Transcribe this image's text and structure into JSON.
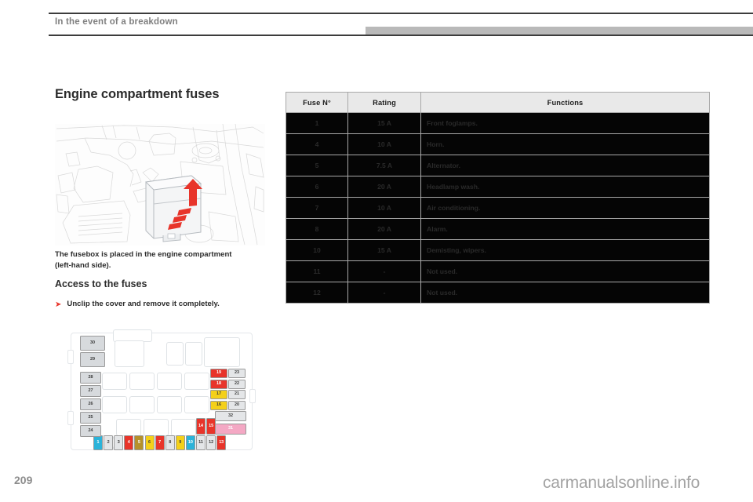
{
  "header": {
    "title": "In the event of a breakdown",
    "tab_icon": "progress-tab-bar"
  },
  "left": {
    "section_title": "Engine compartment fuses",
    "photo_icon": "engine-compartment-fusebox-photo",
    "body_text": "The fusebox is placed in the engine compartment (left-hand side).",
    "subsection_title": "Access to the fuses",
    "bullet_arrow_icon": "red-arrow-bullet-icon",
    "bullet_text": "Unclip the cover and remove it completely.",
    "diagram_icon": "fusebox-layout-diagram"
  },
  "table": {
    "columns": [
      "Fuse N°",
      "Rating",
      "Functions"
    ],
    "rows": [
      {
        "num": "1",
        "rating": "15 A",
        "func": "Front foglamps."
      },
      {
        "num": "4",
        "rating": "10 A",
        "func": "Horn."
      },
      {
        "num": "5",
        "rating": "7.5 A",
        "func": "Alternator."
      },
      {
        "num": "6",
        "rating": "20 A",
        "func": "Headlamp wash."
      },
      {
        "num": "7",
        "rating": "10 A",
        "func": "Air conditioning."
      },
      {
        "num": "8",
        "rating": "20 A",
        "func": "Alarm."
      },
      {
        "num": "10",
        "rating": "15 A",
        "func": "Demisting, wipers."
      },
      {
        "num": "11",
        "rating": "-",
        "func": "Not used."
      },
      {
        "num": "12",
        "rating": "-",
        "func": "Not used."
      }
    ]
  },
  "diagram_data": {
    "bottom_row": [
      {
        "label": "1",
        "color": "#2bb3d9",
        "text": "#ffffff"
      },
      {
        "label": "2",
        "color": "#e4e6e8",
        "text": "#3a3a3a"
      },
      {
        "label": "3",
        "color": "#e4e6e8",
        "text": "#3a3a3a"
      },
      {
        "label": "4",
        "color": "#e8342a",
        "text": "#ffffff"
      },
      {
        "label": "5",
        "color": "#b5912c",
        "text": "#ffffff"
      },
      {
        "label": "6",
        "color": "#f4d019",
        "text": "#3a3a3a"
      },
      {
        "label": "7",
        "color": "#e8342a",
        "text": "#ffffff"
      },
      {
        "label": "8",
        "color": "#e4e6e8",
        "text": "#3a3a3a"
      },
      {
        "label": "9",
        "color": "#f4d019",
        "text": "#3a3a3a"
      },
      {
        "label": "10",
        "color": "#2bb3d9",
        "text": "#ffffff"
      },
      {
        "label": "11",
        "color": "#e4e6e8",
        "text": "#3a3a3a"
      },
      {
        "label": "12",
        "color": "#e4e6e8",
        "text": "#3a3a3a"
      },
      {
        "label": "13",
        "color": "#e8342a",
        "text": "#ffffff"
      }
    ],
    "pair_1415": [
      {
        "label": "14",
        "color": "#e8342a",
        "text": "#ffffff"
      },
      {
        "label": "15",
        "color": "#e8342a",
        "text": "#ffffff"
      }
    ],
    "right_block": [
      {
        "left": "19",
        "left_color": "#e8342a",
        "left_text": "#ffffff",
        "right": "23",
        "right_color": "#e4e6e8",
        "right_text": "#3a3a3a"
      },
      {
        "left": "18",
        "left_color": "#e8342a",
        "left_text": "#ffffff",
        "right": "22",
        "right_color": "#e4e6e8",
        "right_text": "#3a3a3a"
      },
      {
        "left": "17",
        "left_color": "#f4d019",
        "left_text": "#3a3a3a",
        "right": "21",
        "right_color": "#e4e6e8",
        "right_text": "#3a3a3a"
      },
      {
        "left": "16",
        "left_color": "#f4d019",
        "left_text": "#3a3a3a",
        "right": "20",
        "right_color": "#e4e6e8",
        "right_text": "#3a3a3a"
      }
    ],
    "fuse_32": {
      "label": "32",
      "color": "#e4e6e8",
      "text": "#3a3a3a"
    },
    "fuse_31": {
      "label": "31",
      "color": "#f4a8c4",
      "text": "#ffffff"
    },
    "left_column_large": [
      {
        "label": "30",
        "color": "#d7dadd",
        "text": "#3a3a3a"
      },
      {
        "label": "29",
        "color": "#d7dadd",
        "text": "#3a3a3a"
      }
    ],
    "left_column_small": [
      {
        "label": "28",
        "color": "#d7dadd",
        "text": "#3a3a3a"
      },
      {
        "label": "27",
        "color": "#d7dadd",
        "text": "#3a3a3a"
      },
      {
        "label": "26",
        "color": "#d7dadd",
        "text": "#3a3a3a"
      },
      {
        "label": "25",
        "color": "#d7dadd",
        "text": "#3a3a3a"
      },
      {
        "label": "24",
        "color": "#d7dadd",
        "text": "#3a3a3a"
      }
    ]
  },
  "footer": {
    "page_number": "209",
    "watermark": "carmanualsonline.info"
  }
}
